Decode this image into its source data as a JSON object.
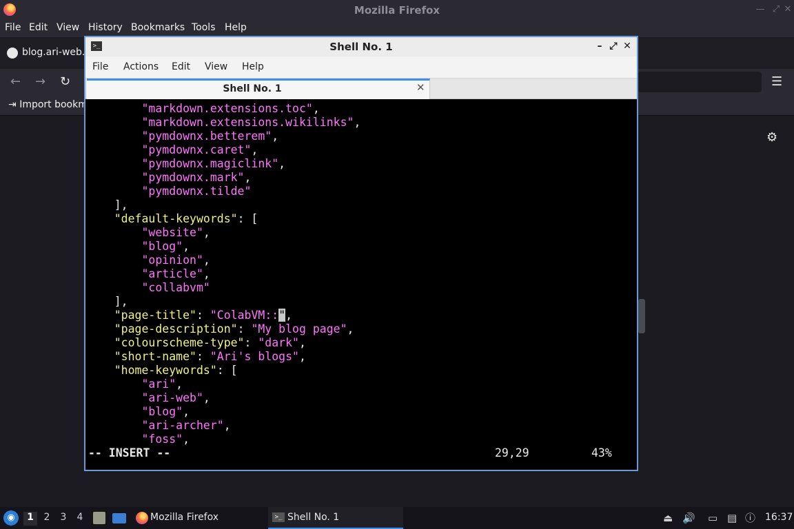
{
  "firefox": {
    "window_title": "Mozilla Firefox",
    "menu": [
      "File",
      "Edit",
      "View",
      "History",
      "Bookmarks",
      "Tools",
      "Help"
    ],
    "tab_label": "blog.ari-web.x",
    "bookmarks_import": "Import bookm",
    "icons": {
      "back": "←",
      "forward": "→",
      "reload": "↻",
      "menu": "☰",
      "settings": "⚙"
    }
  },
  "terminal": {
    "window_title": "Shell No. 1",
    "menu": [
      "File",
      "Actions",
      "Edit",
      "View",
      "Help"
    ],
    "tab_label": "Shell No. 1",
    "colors": {
      "key": "#f2f281",
      "string": "#ff73fd",
      "text": "#e8e8e8",
      "cursor": "#c8c8c8"
    },
    "lines": [
      [
        {
          "t": "        ",
          "c": "w"
        },
        {
          "t": "\"markdown.extensions.toc\"",
          "c": "s"
        },
        {
          "t": ",",
          "c": "w"
        }
      ],
      [
        {
          "t": "        ",
          "c": "w"
        },
        {
          "t": "\"markdown.extensions.wikilinks\"",
          "c": "s"
        },
        {
          "t": ",",
          "c": "w"
        }
      ],
      [
        {
          "t": "        ",
          "c": "w"
        },
        {
          "t": "\"pymdownx.betterem\"",
          "c": "s"
        },
        {
          "t": ",",
          "c": "w"
        }
      ],
      [
        {
          "t": "        ",
          "c": "w"
        },
        {
          "t": "\"pymdownx.caret\"",
          "c": "s"
        },
        {
          "t": ",",
          "c": "w"
        }
      ],
      [
        {
          "t": "        ",
          "c": "w"
        },
        {
          "t": "\"pymdownx.magiclink\"",
          "c": "s"
        },
        {
          "t": ",",
          "c": "w"
        }
      ],
      [
        {
          "t": "        ",
          "c": "w"
        },
        {
          "t": "\"pymdownx.mark\"",
          "c": "s"
        },
        {
          "t": ",",
          "c": "w"
        }
      ],
      [
        {
          "t": "        ",
          "c": "w"
        },
        {
          "t": "\"pymdownx.tilde\"",
          "c": "s"
        }
      ],
      [
        {
          "t": "    ],",
          "c": "w"
        }
      ],
      [
        {
          "t": "    ",
          "c": "w"
        },
        {
          "t": "\"default-keywords\"",
          "c": "k"
        },
        {
          "t": ": [",
          "c": "w"
        }
      ],
      [
        {
          "t": "        ",
          "c": "w"
        },
        {
          "t": "\"website\"",
          "c": "s"
        },
        {
          "t": ",",
          "c": "w"
        }
      ],
      [
        {
          "t": "        ",
          "c": "w"
        },
        {
          "t": "\"blog\"",
          "c": "s"
        },
        {
          "t": ",",
          "c": "w"
        }
      ],
      [
        {
          "t": "        ",
          "c": "w"
        },
        {
          "t": "\"opinion\"",
          "c": "s"
        },
        {
          "t": ",",
          "c": "w"
        }
      ],
      [
        {
          "t": "        ",
          "c": "w"
        },
        {
          "t": "\"article\"",
          "c": "s"
        },
        {
          "t": ",",
          "c": "w"
        }
      ],
      [
        {
          "t": "        ",
          "c": "w"
        },
        {
          "t": "\"collabvm\"",
          "c": "s"
        }
      ],
      [
        {
          "t": "    ],",
          "c": "w"
        }
      ],
      [
        {
          "t": "    ",
          "c": "w"
        },
        {
          "t": "\"page-title\"",
          "c": "k"
        },
        {
          "t": ": ",
          "c": "w"
        },
        {
          "t": "\"ColabVM::",
          "c": "s"
        },
        {
          "t": "\"",
          "c": "c"
        },
        {
          "t": ",",
          "c": "w"
        }
      ],
      [
        {
          "t": "    ",
          "c": "w"
        },
        {
          "t": "\"page-description\"",
          "c": "k"
        },
        {
          "t": ": ",
          "c": "w"
        },
        {
          "t": "\"My blog page\"",
          "c": "s"
        },
        {
          "t": ",",
          "c": "w"
        }
      ],
      [
        {
          "t": "    ",
          "c": "w"
        },
        {
          "t": "\"colourscheme-type\"",
          "c": "k"
        },
        {
          "t": ": ",
          "c": "w"
        },
        {
          "t": "\"dark\"",
          "c": "s"
        },
        {
          "t": ",",
          "c": "w"
        }
      ],
      [
        {
          "t": "    ",
          "c": "w"
        },
        {
          "t": "\"short-name\"",
          "c": "k"
        },
        {
          "t": ": ",
          "c": "w"
        },
        {
          "t": "\"Ari's blogs\"",
          "c": "s"
        },
        {
          "t": ",",
          "c": "w"
        }
      ],
      [
        {
          "t": "    ",
          "c": "w"
        },
        {
          "t": "\"home-keywords\"",
          "c": "k"
        },
        {
          "t": ": [",
          "c": "w"
        }
      ],
      [
        {
          "t": "        ",
          "c": "w"
        },
        {
          "t": "\"ari\"",
          "c": "s"
        },
        {
          "t": ",",
          "c": "w"
        }
      ],
      [
        {
          "t": "        ",
          "c": "w"
        },
        {
          "t": "\"ari-web\"",
          "c": "s"
        },
        {
          "t": ",",
          "c": "w"
        }
      ],
      [
        {
          "t": "        ",
          "c": "w"
        },
        {
          "t": "\"blog\"",
          "c": "s"
        },
        {
          "t": ",",
          "c": "w"
        }
      ],
      [
        {
          "t": "        ",
          "c": "w"
        },
        {
          "t": "\"ari-archer\"",
          "c": "s"
        },
        {
          "t": ",",
          "c": "w"
        }
      ],
      [
        {
          "t": "        ",
          "c": "w"
        },
        {
          "t": "\"foss\"",
          "c": "s"
        },
        {
          "t": ",",
          "c": "w"
        }
      ]
    ],
    "status": {
      "mode": "-- INSERT --",
      "position": "29,29",
      "percent": "43%"
    }
  },
  "taskbar": {
    "workspaces": [
      "1",
      "2",
      "3",
      "4"
    ],
    "tasks": [
      "Mozilla Firefox",
      "Shell No. 1"
    ],
    "clock": "16:37"
  }
}
